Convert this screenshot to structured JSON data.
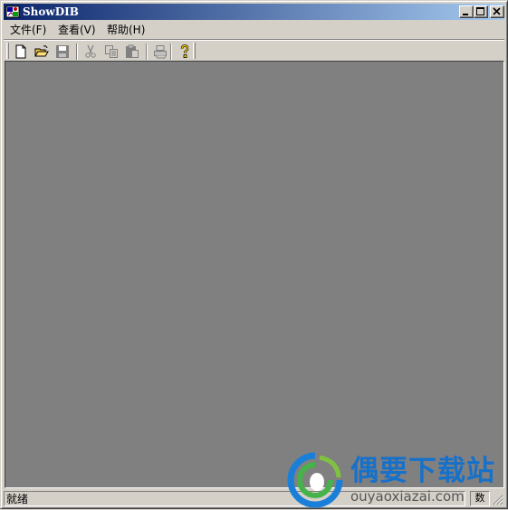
{
  "window": {
    "title": "ShowDIB",
    "min_label": "",
    "max_label": "",
    "close_label": ""
  },
  "menubar": {
    "items": [
      {
        "label": "文件(F)"
      },
      {
        "label": "查看(V)"
      },
      {
        "label": "帮助(H)"
      }
    ]
  },
  "toolbar": {
    "buttons": [
      {
        "icon": "new-file-icon",
        "enabled": true
      },
      {
        "icon": "open-folder-icon",
        "enabled": true
      },
      {
        "icon": "save-icon",
        "enabled": false
      },
      {
        "icon": "cut-icon",
        "enabled": false
      },
      {
        "icon": "copy-icon",
        "enabled": false
      },
      {
        "icon": "paste-icon",
        "enabled": false
      },
      {
        "icon": "print-icon",
        "enabled": false
      },
      {
        "icon": "help-icon",
        "enabled": true
      }
    ]
  },
  "client_area": {
    "background": "#808080"
  },
  "statusbar": {
    "text": "就绪",
    "indicator": "数"
  },
  "watermark": {
    "title": "偶要下载站",
    "url": "ouyaoxiazai.com"
  },
  "colors": {
    "titlebar_start": "#0a246a",
    "titlebar_end": "#a6caf0",
    "face": "#d4d0c8",
    "watermark_blue": "#1771c9"
  }
}
